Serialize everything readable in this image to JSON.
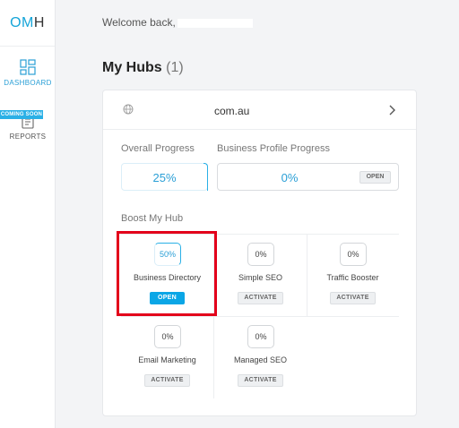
{
  "app": {
    "logo_left": "OM",
    "logo_right": "H"
  },
  "sidebar": {
    "items": [
      {
        "label": "DASHBOARD",
        "icon": "dashboard-icon",
        "active": true
      },
      {
        "label": "REPORTS",
        "icon": "reports-icon",
        "badge": "COMING SOON"
      }
    ]
  },
  "header": {
    "welcome": "Welcome back,"
  },
  "hubs": {
    "title": "My Hubs",
    "count": "(1)",
    "card": {
      "domain": "com.au",
      "overall_label": "Overall Progress",
      "overall_value": "25%",
      "bpp_label": "Business Profile Progress",
      "bpp_value": "0%",
      "bpp_button": "OPEN",
      "boost_label": "Boost My Hub",
      "tiles": [
        {
          "progress": "50%",
          "name": "Business Directory",
          "button": "OPEN"
        },
        {
          "progress": "0%",
          "name": "Simple SEO",
          "button": "ACTIVATE"
        },
        {
          "progress": "0%",
          "name": "Traffic Booster",
          "button": "ACTIVATE"
        },
        {
          "progress": "0%",
          "name": "Email Marketing",
          "button": "ACTIVATE"
        },
        {
          "progress": "0%",
          "name": "Managed SEO",
          "button": "ACTIVATE"
        }
      ]
    }
  },
  "colors": {
    "accent": "#14a4d8",
    "highlight": "#e3001b",
    "background": "#f3f4f6"
  }
}
